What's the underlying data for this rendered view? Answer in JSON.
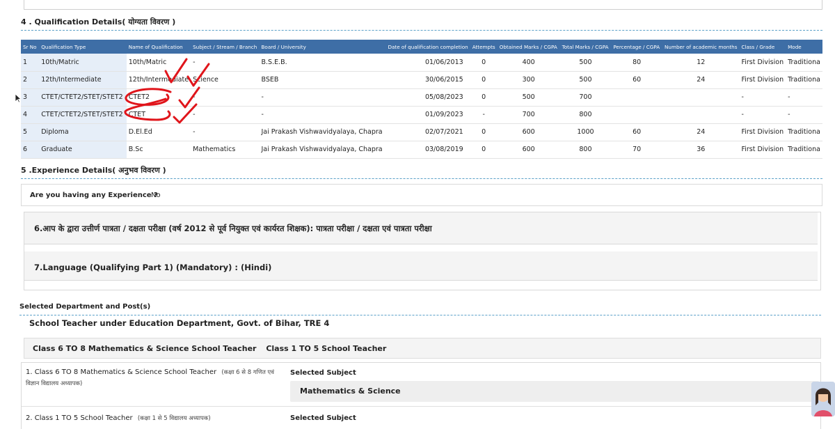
{
  "section4": {
    "title": "4 . Qualification Details( योग्यता विवरण )",
    "headers": [
      "Sr No",
      "Qualification Type",
      "Name of Qualification",
      "Subject / Stream / Branch",
      "Board / University",
      "Date of qualification completion",
      "Attempts",
      "Obtained Marks / CGPA",
      "Total Marks / CGPA",
      "Percentage / CGPA",
      "Number of academic months",
      "Class / Grade",
      "Mode"
    ],
    "rows": [
      [
        "1",
        "10th/Matric",
        "10th/Matric",
        "-",
        "B.S.E.B.",
        "01/06/2013",
        "0",
        "400",
        "500",
        "80",
        "12",
        "First Division",
        "Traditiona"
      ],
      [
        "2",
        "12th/Intermediate",
        "12th/Intermediate",
        "Science",
        "BSEB",
        "30/06/2015",
        "0",
        "300",
        "500",
        "60",
        "24",
        "First Division",
        "Traditiona"
      ],
      [
        "3",
        "CTET/CTET2/STET/STET2",
        "CTET2",
        "-",
        "-",
        "05/08/2023",
        "0",
        "500",
        "700",
        "",
        "",
        "-",
        "-"
      ],
      [
        "4",
        "CTET/CTET2/STET/STET2",
        "CTET",
        "-",
        "-",
        "01/09/2023",
        "-",
        "700",
        "800",
        "",
        "",
        "-",
        "-"
      ],
      [
        "5",
        "Diploma",
        "D.El.Ed",
        "-",
        "Jai Prakash Vishwavidyalaya, Chapra",
        "02/07/2021",
        "0",
        "600",
        "1000",
        "60",
        "24",
        "First Division",
        "Traditiona"
      ],
      [
        "6",
        "Graduate",
        "B.Sc",
        "Mathematics",
        "Jai Prakash Vishwavidyalaya, Chapra",
        "03/08/2019",
        "0",
        "600",
        "800",
        "70",
        "36",
        "First Division",
        "Traditiona"
      ]
    ]
  },
  "section5": {
    "title": "5 .Experience Details( अनुभव विवरण )",
    "question": "Are you having any Experience ?",
    "answer": "No"
  },
  "section6": {
    "title": "6.आप के द्वारा उत्तीर्ण पात्रता / दक्षता परीक्षा (वर्ष 2012 से पूर्व नियुक्त एवं कार्यरत शिक्षक): पात्रता परीक्षा / दक्षता एवं पात्रता परीक्षा"
  },
  "section7": {
    "title": "7.Language (Qualifying Part 1) (Mandatory) :  (Hindi)"
  },
  "posts": {
    "title": "Selected Department and Post(s)",
    "department": "School Teacher under Education Department, Govt. of Bihar, TRE 4",
    "post_tabs": [
      "Class 6 TO 8 Mathematics & Science School Teacher",
      "Class 1 TO 5 School Teacher"
    ],
    "post1_label": "1. Class 6 TO 8 Mathematics & Science School Teacher",
    "post1_hindi_a": "(कक्षा 6 से 8 गणित एवं",
    "post1_hindi_b": "विज्ञान विद्यालय अध्यापक)",
    "selected_subject_label": "Selected Subject",
    "post1_subject": "Mathematics & Science",
    "post2_label": "2. Class 1 TO 5 School Teacher",
    "post2_hindi": "(कक्षा 1 से 5 विद्यालय अध्यापक)",
    "selected_subject_label2": "Selected Subject"
  },
  "colors": {
    "header_blue": "#3e6ea6",
    "row_label_bg": "#e6eef8",
    "annotation_red": "#e0151b",
    "dashed_line": "#5aa0c8"
  }
}
